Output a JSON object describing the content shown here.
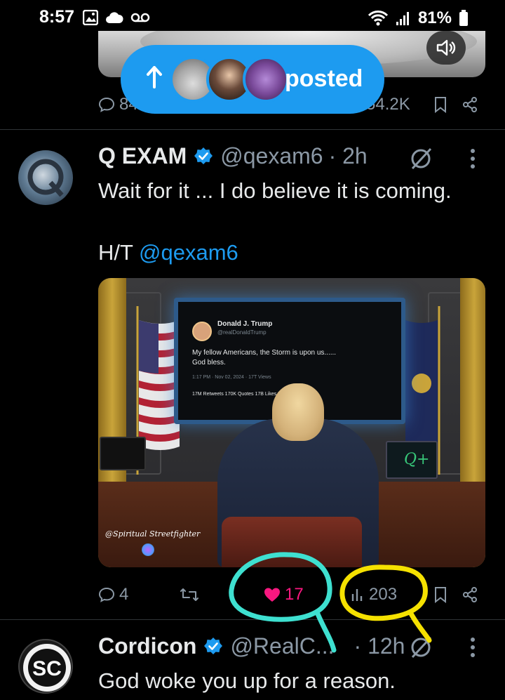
{
  "status_bar": {
    "time": "8:57",
    "battery": "81%"
  },
  "prev_tweet": {
    "reply_count": "84",
    "view_count": "54.2K"
  },
  "posted_pill": {
    "label": "posted"
  },
  "tweet1": {
    "name": "Q EXAM",
    "handle": "@qexam6",
    "time": "· 2h",
    "text_line1": "Wait for it ... I do believe it is coming.",
    "ht_prefix": "H/T ",
    "ht_mention": "@qexam6",
    "image": {
      "screen_name": "Donald J. Trump",
      "screen_handle": "@realDonaldTrump",
      "screen_text_1": "My fellow Americans, the Storm is upon us......",
      "screen_text_2": "God bless.",
      "screen_meta": "1:17 PM · Nov 02, 2024 · 17T Views",
      "screen_stats": "17M Retweets  170K Quotes  17B Likes  Bookmarks",
      "watermark": "@Spiritual Streetfighter"
    },
    "reply_count": "4",
    "like_count": "17",
    "view_count": "203"
  },
  "tweet2": {
    "name": "Cordicon",
    "handle": "@RealC...",
    "time": "· 12h",
    "text": "God woke you up for a reason."
  },
  "colors": {
    "accent": "#1d9bf0",
    "like": "#f91880",
    "muted": "#8b98a5",
    "annot_cyan": "#3ee0d0",
    "annot_yellow": "#f5e100"
  }
}
